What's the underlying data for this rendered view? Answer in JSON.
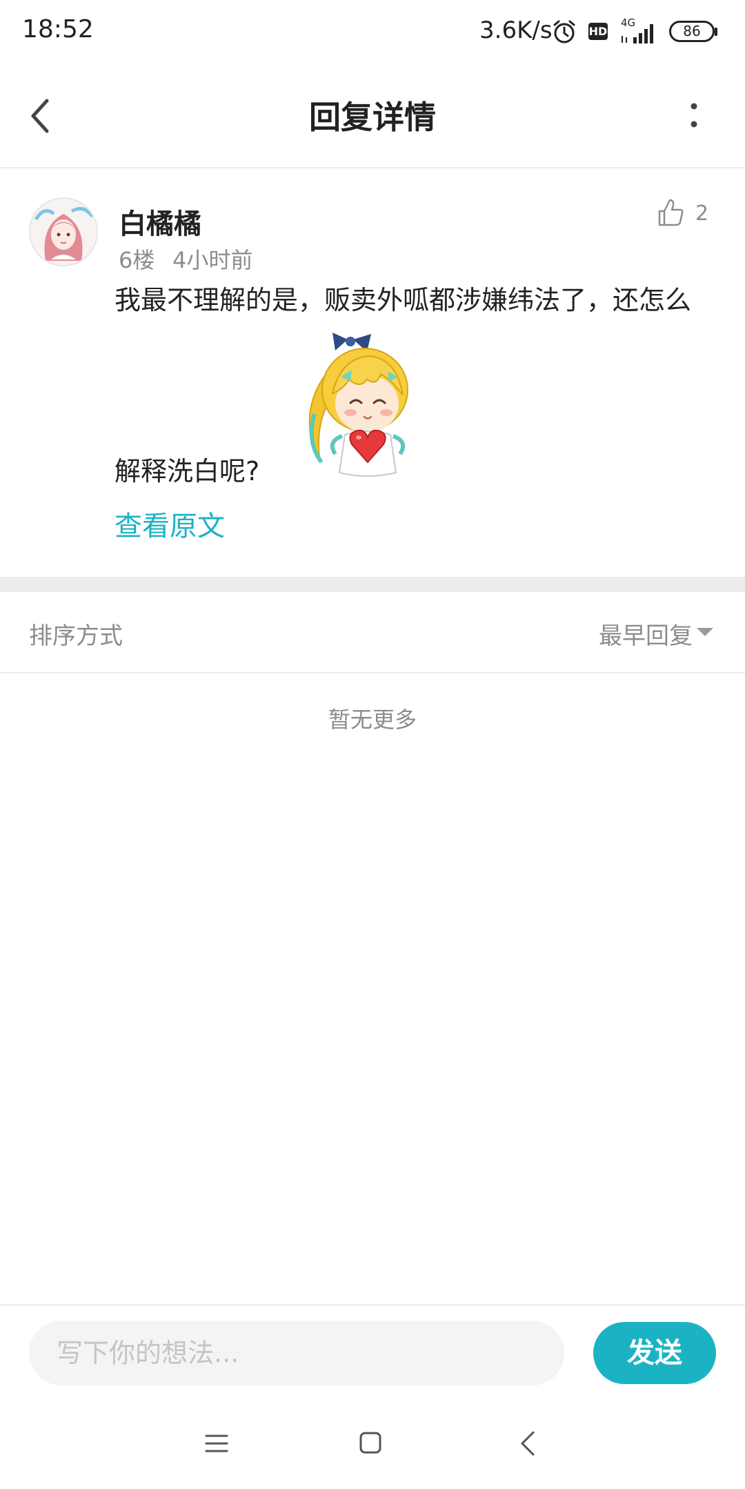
{
  "status_bar": {
    "time": "18:52",
    "network_speed": "3.6K/s",
    "hd_label": "HD",
    "network_type": "4G",
    "battery": "86",
    "icons": [
      "alarm-icon",
      "signal-icon"
    ]
  },
  "nav": {
    "title": "回复详情",
    "back_icon": "back-arrow-icon",
    "more_icon": "more-vertical-icon"
  },
  "post": {
    "username": "白橘橘",
    "floor": "6楼",
    "time_ago": "4小时前",
    "like_count": "2",
    "text_line1": "我最不理解的是，贩卖外呱都涉嫌纬法了，还怎么",
    "text_line2": "解释洗白呢?",
    "view_original": "查看原文",
    "sticker": "heart-sticker-image"
  },
  "sort": {
    "label": "排序方式",
    "value": "最早回复"
  },
  "replies": {
    "empty_text": "暂无更多"
  },
  "composer": {
    "placeholder": "写下你的想法...",
    "send_label": "发送"
  },
  "colors": {
    "accent": "#1bb3c4",
    "muted_text": "#8c8c8c",
    "divider": "#ececec"
  }
}
